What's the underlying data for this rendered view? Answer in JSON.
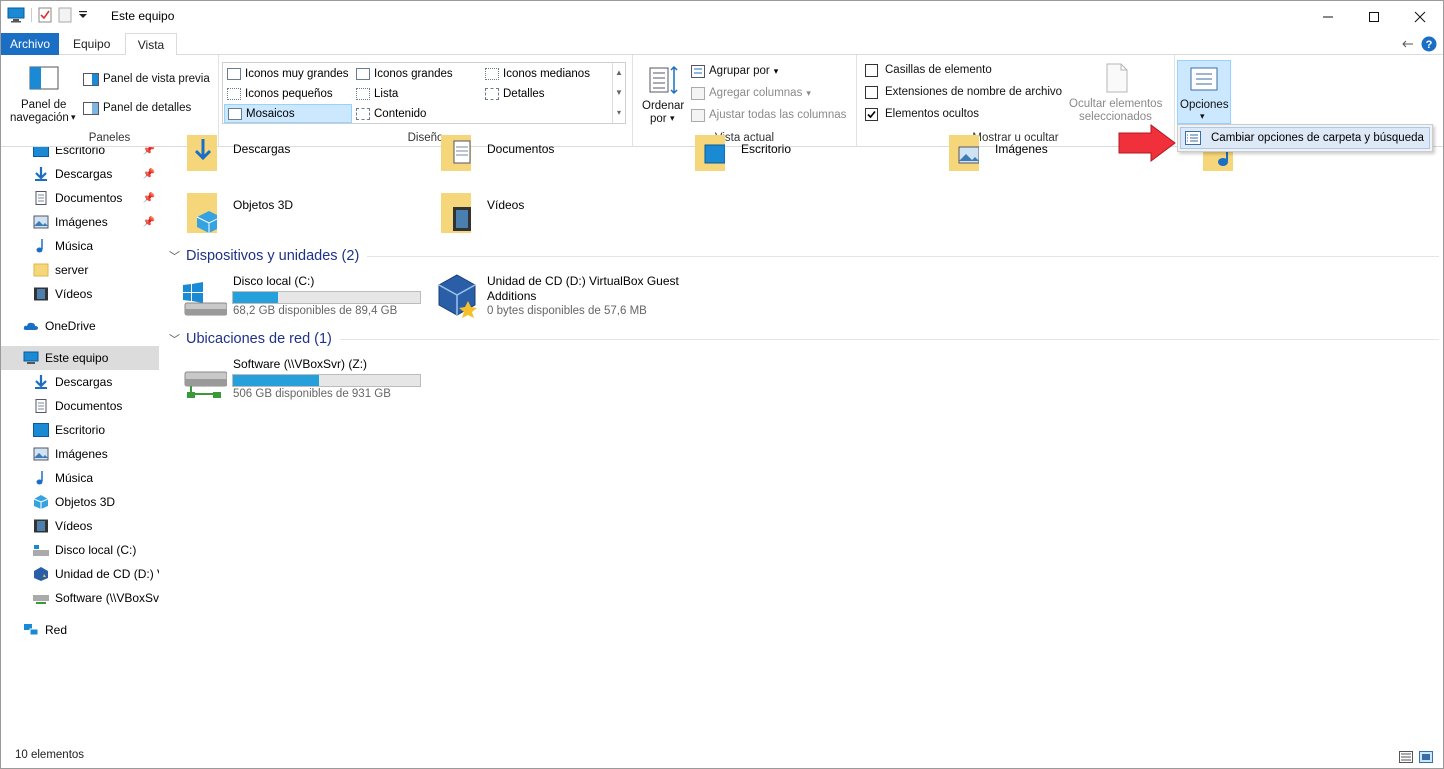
{
  "window": {
    "title": "Este equipo"
  },
  "tabs": [
    "Archivo",
    "Equipo",
    "Vista"
  ],
  "ribbon": {
    "paneles": {
      "label": "Paneles",
      "nav_pane_line1": "Panel de",
      "nav_pane_line2": "navegación",
      "preview_pane": "Panel de vista previa",
      "details_pane": "Panel de detalles"
    },
    "diseno": {
      "label": "Diseño",
      "items": [
        "Iconos muy grandes",
        "Iconos grandes",
        "Iconos medianos",
        "Iconos pequeños",
        "Lista",
        "Detalles",
        "Mosaicos",
        "Contenido"
      ],
      "selected": "Mosaicos"
    },
    "vista_actual": {
      "label": "Vista actual",
      "sort_line1": "Ordenar",
      "sort_line2": "por",
      "group_by": "Agrupar por",
      "add_columns": "Agregar columnas",
      "fit_columns": "Ajustar todas las columnas"
    },
    "mostrar": {
      "label": "Mostrar u ocultar",
      "checkboxes": "Casillas de elemento",
      "extensions": "Extensiones de nombre de archivo",
      "hidden": "Elementos ocultos",
      "hide_selected_line1": "Ocultar elementos",
      "hide_selected_line2": "seleccionados",
      "checkbox_states": {
        "checkboxes": false,
        "extensions": false,
        "hidden": true
      }
    },
    "options": {
      "label": "Opciones"
    }
  },
  "dropdown": {
    "item": "Cambiar opciones de carpeta y búsqueda"
  },
  "nav": {
    "quick": [
      "Escritorio",
      "Descargas",
      "Documentos",
      "Imágenes",
      "Música",
      "server",
      "Vídeos"
    ],
    "onedrive": "OneDrive",
    "this_pc": "Este equipo",
    "pc_items": [
      "Descargas",
      "Documentos",
      "Escritorio",
      "Imágenes",
      "Música",
      "Objetos 3D",
      "Vídeos",
      "Disco local (C:)",
      "Unidad de CD (D:) V",
      "Software (\\\\VBoxSv"
    ],
    "network": "Red"
  },
  "folders": {
    "top_row": [
      "Descargas",
      "Documentos",
      "Escritorio",
      "Imágenes"
    ],
    "second_row": [
      "Objetos 3D",
      "Vídeos"
    ]
  },
  "devices": {
    "header": "Dispositivos y unidades (2)",
    "c_name": "Disco local (C:)",
    "c_free": "68,2 GB disponibles de 89,4 GB",
    "c_fill": 0.24,
    "d_name_line1": "Unidad de CD (D:) VirtualBox Guest",
    "d_name_line2": "Additions",
    "d_free": "0 bytes disponibles de 57,6 MB"
  },
  "network": {
    "header": "Ubicaciones de red (1)",
    "z_name": "Software (\\\\VBoxSvr) (Z:)",
    "z_free": "506 GB disponibles de 931 GB",
    "z_fill": 0.46
  },
  "status": {
    "count": "10 elementos"
  }
}
